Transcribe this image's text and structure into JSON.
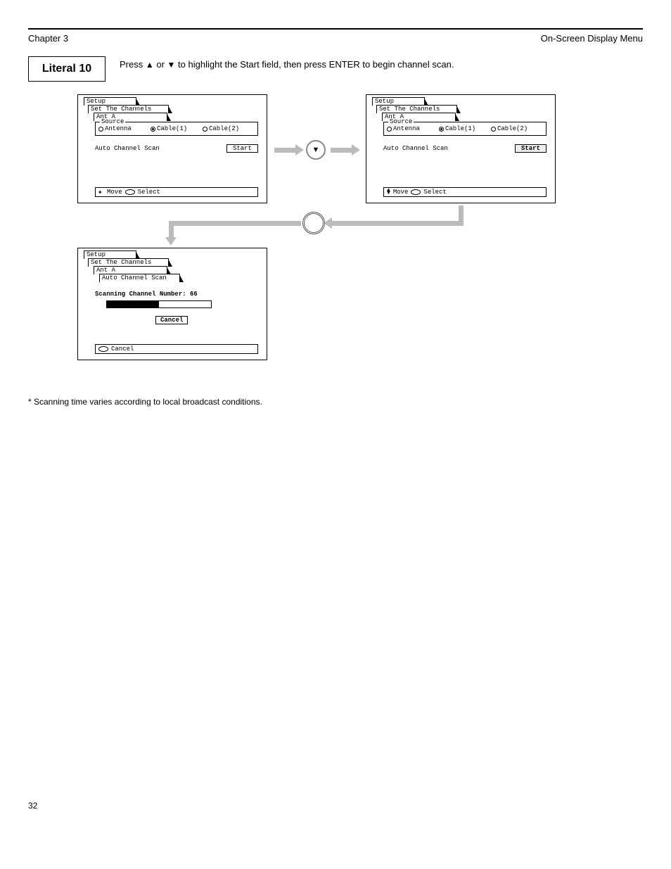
{
  "header": {
    "left": "Chapter 3",
    "right": "On-Screen Display Menu",
    "rule": true
  },
  "instruction1": {
    "literal": "Literal 10",
    "text_before": "Press ",
    "arrow_up": "▲",
    "mid": " or ",
    "arrow_down": "▼",
    "text_after": " to highlight the Start field, then press ENTER to begin channel scan."
  },
  "screens": {
    "tabs": {
      "setup": "Setup",
      "set_channels": "Set The Channels",
      "ant": "Ant A",
      "auto_scan": "Auto Channel Scan"
    },
    "source": {
      "label": "Source",
      "options": [
        "Antenna",
        "Cable(1)",
        "Cable(2)"
      ],
      "selected": "Cable(1)"
    },
    "auto_row": {
      "label": "Auto Channel Scan",
      "button": "Start"
    },
    "footer": {
      "move": "Move",
      "select": "Select"
    },
    "scanning": {
      "label_prefix": "Scanning Channel Number: ",
      "number": "66",
      "cancel": "Cancel",
      "footer": "Cancel",
      "progress_percent": 50
    }
  },
  "remote": {
    "arrow_btn": "▼",
    "enter_btn": " "
  },
  "note": "*  Scanning time varies according to local broadcast conditions.",
  "page": "32"
}
